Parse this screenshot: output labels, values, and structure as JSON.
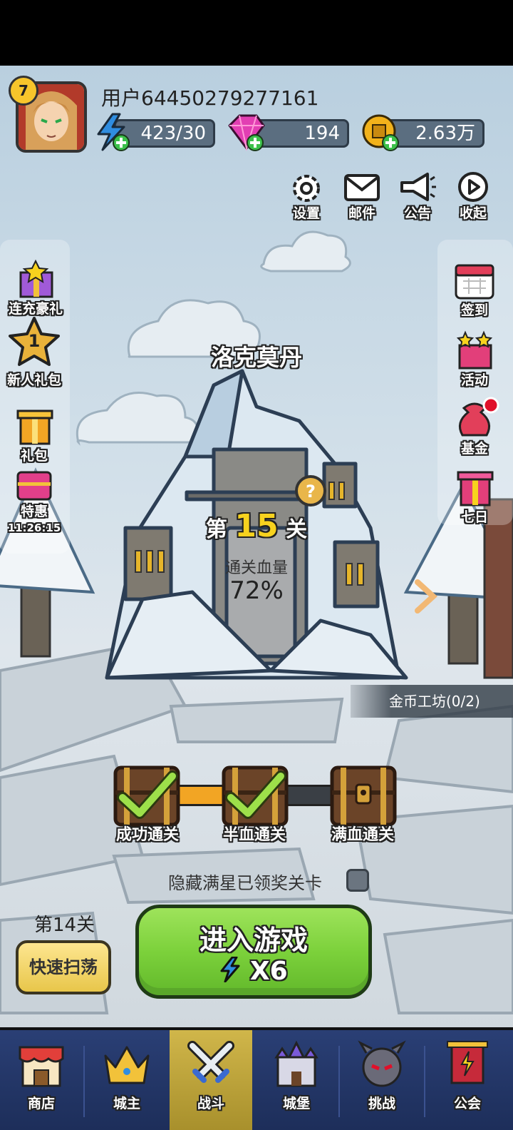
{
  "player": {
    "level": "7",
    "username": "用户64450279277161",
    "energy": "423/30",
    "gems": "194",
    "gold": "2.63万"
  },
  "top_menu": [
    {
      "label": "设置",
      "icon": "gear-icon"
    },
    {
      "label": "邮件",
      "icon": "mail-icon"
    },
    {
      "label": "公告",
      "icon": "megaphone-icon"
    },
    {
      "label": "收起",
      "icon": "play-icon"
    }
  ],
  "left_menu": {
    "recharge": "连充豪礼",
    "newbie_badge": "1",
    "newbie": "新人礼包",
    "gift": "礼包",
    "special": "特惠",
    "special_timer": "11:26:15"
  },
  "right_menu": {
    "signin": "签到",
    "activity": "活动",
    "fund": "基金",
    "seven_day": "七日"
  },
  "stage": {
    "map_name": "洛克莫丹",
    "prefix": "第",
    "number": "15",
    "suffix": "关",
    "clear_hp_label": "通关血量",
    "clear_hp_value": "72%"
  },
  "gold_workshop": "金币工坊(0/2)",
  "chests": [
    {
      "label": "成功通关",
      "claimed": true
    },
    {
      "label": "半血通关",
      "claimed": true
    },
    {
      "label": "满血通关",
      "claimed": false
    }
  ],
  "star_progress": 0.5,
  "hidden_toggle_label": "隐藏满星已领奖关卡",
  "last_stage": "第14关",
  "sweep_label": "快速扫荡",
  "enter_label": "进入游戏",
  "enter_cost": "X6",
  "nav": [
    {
      "label": "商店",
      "icon": "shop-icon"
    },
    {
      "label": "城主",
      "icon": "crown-icon"
    },
    {
      "label": "战斗",
      "icon": "crossed-swords-icon",
      "active": true
    },
    {
      "label": "城堡",
      "icon": "castle-icon"
    },
    {
      "label": "挑战",
      "icon": "demon-icon"
    },
    {
      "label": "公会",
      "icon": "guild-banner-icon"
    }
  ],
  "colors": {
    "energy": "#2f8de0",
    "gem": "#e23fb3",
    "gold": "#f2b21b",
    "enter_button": "#7cd13b",
    "nav_bg": "#2a3f75",
    "nav_active": "#c2a83c"
  }
}
